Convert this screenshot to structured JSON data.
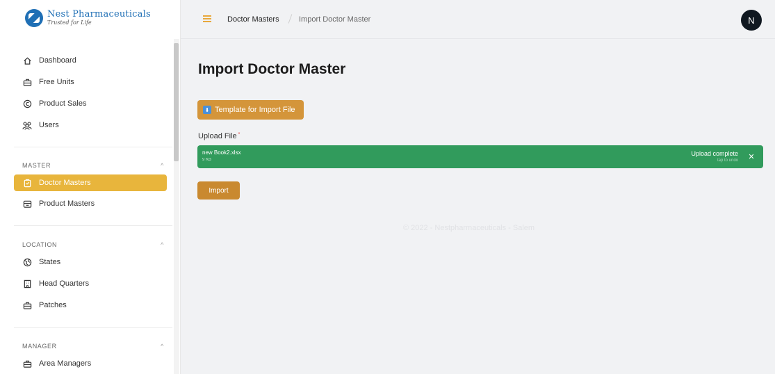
{
  "brand": {
    "name": "Nest Pharmaceuticals",
    "tagline": "Trusted for Life"
  },
  "sidebar": {
    "top_items": [
      {
        "label": "Dashboard",
        "icon": "home-icon"
      },
      {
        "label": "Free Units",
        "icon": "briefcase-icon"
      },
      {
        "label": "Product Sales",
        "icon": "copyright-icon"
      },
      {
        "label": "Users",
        "icon": "users-icon"
      }
    ],
    "sections": [
      {
        "title": "MASTER",
        "items": [
          {
            "label": "Doctor Masters",
            "icon": "clipboard-icon",
            "active": true
          },
          {
            "label": "Product Masters",
            "icon": "box-icon",
            "active": false
          }
        ]
      },
      {
        "title": "LOCATION",
        "items": [
          {
            "label": "States",
            "icon": "globe-icon"
          },
          {
            "label": "Head Quarters",
            "icon": "building-icon"
          },
          {
            "label": "Patches",
            "icon": "briefcase-icon"
          }
        ]
      },
      {
        "title": "MANAGER",
        "items": [
          {
            "label": "Area Managers",
            "icon": "briefcase-icon"
          }
        ]
      }
    ]
  },
  "header": {
    "breadcrumb": [
      "Doctor Masters",
      "Import Doctor Master"
    ],
    "avatar_initial": "N"
  },
  "main": {
    "title": "Import Doctor Master",
    "template_button": "Template for Import File",
    "upload_label": "Upload File",
    "upload_required_mark": "*",
    "file": {
      "name": "new Book2.xlsx",
      "size": "9 KB",
      "status": "Upload complete",
      "undo_hint": "tap to undo"
    },
    "import_button": "Import",
    "footer": "© 2022 - Nestpharmaceuticals - Salem"
  },
  "colors": {
    "accent": "#e8b53c",
    "button": "#d4953a",
    "upload_success": "#319b5c",
    "brand": "#1f6fb5"
  }
}
